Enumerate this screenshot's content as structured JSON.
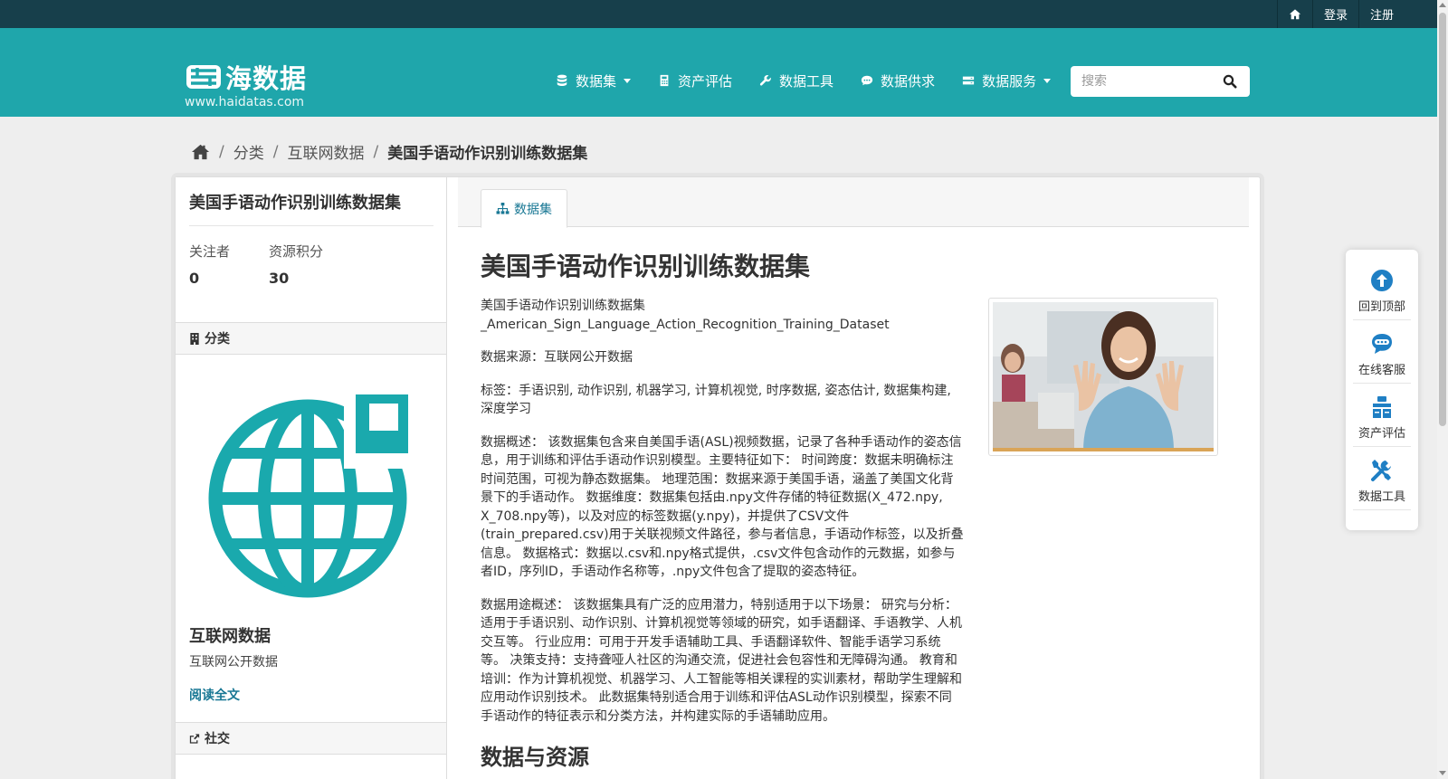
{
  "colors": {
    "account_bar": "#173f4b",
    "masthead": "#1fa6ab",
    "link": "#187794",
    "logo_teal": "#1aa9ad",
    "float_icon": "#1f7fc4"
  },
  "account": {
    "home_icon": "home-icon",
    "login": "登录",
    "register": "注册"
  },
  "brand": {
    "name": "海数据",
    "url": "www.haidatas.com"
  },
  "nav": {
    "items": [
      {
        "label": "数据集",
        "icon": "database-icon",
        "dropdown": true
      },
      {
        "label": "资产评估",
        "icon": "calculator-icon",
        "dropdown": false
      },
      {
        "label": "数据工具",
        "icon": "wrench-icon",
        "dropdown": false
      },
      {
        "label": "数据供求",
        "icon": "comment-icon",
        "dropdown": false
      },
      {
        "label": "数据服务",
        "icon": "server-icon",
        "dropdown": true
      }
    ]
  },
  "search": {
    "placeholder": "搜索",
    "value": ""
  },
  "breadcrumb": {
    "items": [
      "分类",
      "互联网数据"
    ],
    "current": "美国手语动作识别训练数据集"
  },
  "sidebar": {
    "title": "美国手语动作识别训练数据集",
    "followers_label": "关注者",
    "followers_value": "0",
    "points_label": "资源积分",
    "points_value": "30",
    "category_heading": "分类",
    "org_name": "互联网数据",
    "org_desc": "互联网公开数据",
    "read_more": "阅读全文",
    "social_heading": "社交"
  },
  "content": {
    "tab_label": "数据集",
    "title": "美国手语动作识别训练数据集",
    "p_name_cn": "美国手语动作识别训练数据集",
    "p_name_en": "_American_Sign_Language_Action_Recognition_Training_Dataset",
    "p_source": "数据来源：互联网公开数据",
    "p_tags": "标签：手语识别, 动作识别, 机器学习, 计算机视觉, 时序数据, 姿态估计, 数据集构建, 深度学习",
    "p_overview": "数据概述： 该数据集包含来自美国手语(ASL)视频数据，记录了各种手语动作的姿态信息，用于训练和评估手语动作识别模型。主要特征如下： 时间跨度：数据未明确标注时间范围，可视为静态数据集。 地理范围：数据来源于美国手语，涵盖了美国文化背景下的手语动作。 数据维度：数据集包括由.npy文件存储的特征数据(X_472.npy, X_708.npy等)，以及对应的标签数据(y.npy)，并提供了CSV文件(train_prepared.csv)用于关联视频文件路径，参与者信息，手语动作标签，以及折叠信息。 数据格式：数据以.csv和.npy格式提供，.csv文件包含动作的元数据，如参与者ID，序列ID，手语动作名称等，.npy文件包含了提取的姿态特征。",
    "p_usage": "数据用途概述： 该数据集具有广泛的应用潜力，特别适用于以下场景： 研究与分析：适用于手语识别、动作识别、计算机视觉等领域的研究，如手语翻译、手语教学、人机交互等。 行业应用：可用于开发手语辅助工具、手语翻译软件、智能手语学习系统等。 决策支持：支持聋哑人社区的沟通交流，促进社会包容性和无障碍沟通。 教育和培训：作为计算机视觉、机器学习、人工智能等相关课程的实训素材，帮助学生理解和应用动作识别技术。 此数据集特别适合用于训练和评估ASL动作识别模型，探索不同手语动作的特征表示和分类方法，并构建实际的手语辅助应用。",
    "section_heading": "数据与资源"
  },
  "float_tools": {
    "items": [
      {
        "label": "回到顶部",
        "icon": "arrow-up-circle-icon"
      },
      {
        "label": "在线客服",
        "icon": "chat-bubble-icon"
      },
      {
        "label": "资产评估",
        "icon": "asset-evaluate-icon"
      },
      {
        "label": "数据工具",
        "icon": "tools-icon"
      }
    ]
  }
}
